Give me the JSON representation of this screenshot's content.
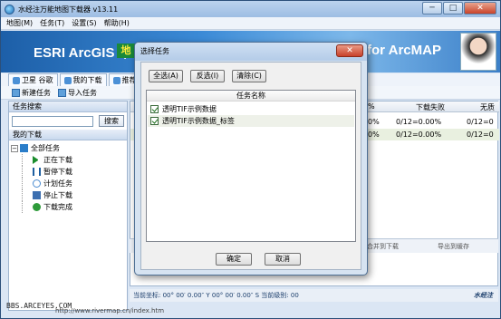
{
  "window": {
    "title": "水经注万能地图下载器 v13.11",
    "controls": [
      "─",
      "□",
      "✕"
    ]
  },
  "menu": [
    "地图(M)",
    "任务(T)",
    "设置(S)",
    "帮助(H)"
  ],
  "banner": {
    "left_text": "ESRI ArcGIS 中",
    "logo_text": "地",
    "right_text": "for ArcMAP"
  },
  "tabs": [
    "卫星 谷歌",
    "我的下载",
    "推荐"
  ],
  "toolbar": [
    "新建任务",
    "导入任务"
  ],
  "left_panel": {
    "search_header": "任务搜索",
    "search_button": "搜索",
    "downloads_header": "我的下载",
    "tree_root": "全部任务",
    "tree_items": [
      "正在下载",
      "暂停下载",
      "计划任务",
      "停止下载",
      "下载完成"
    ]
  },
  "right_table": {
    "columns": [
      "%",
      "下载失败",
      "无质"
    ],
    "rows": [
      [
        "0%",
        "0/12=0.00%",
        "0/12=0"
      ],
      [
        "0%",
        "0/12=0.00%",
        "0/12=0"
      ]
    ],
    "hidden_hint": "打开存储目录"
  },
  "bottom_bar": {
    "left": "合并到下载",
    "right": "导出到缓存"
  },
  "status_bar": {
    "text": "当前坐标:    00° 00′   0.00″ Y  00° 00′   0.00″ S   当前级别:  00",
    "logo": "水经注"
  },
  "watermark": "BBS.ARCEYES.COM",
  "url_text": "http://www.rivermap.cn/index.htm",
  "dialog": {
    "title": "选择任务",
    "close": "✕",
    "buttons": {
      "select_all": "全选(A)",
      "invert": "反选(I)",
      "clear": "清除(C)",
      "ok": "确定",
      "cancel": "取消"
    },
    "list_header": "任务名称",
    "items": [
      "透明TIF示例数据",
      "透明TIF示例数据_标签"
    ]
  }
}
